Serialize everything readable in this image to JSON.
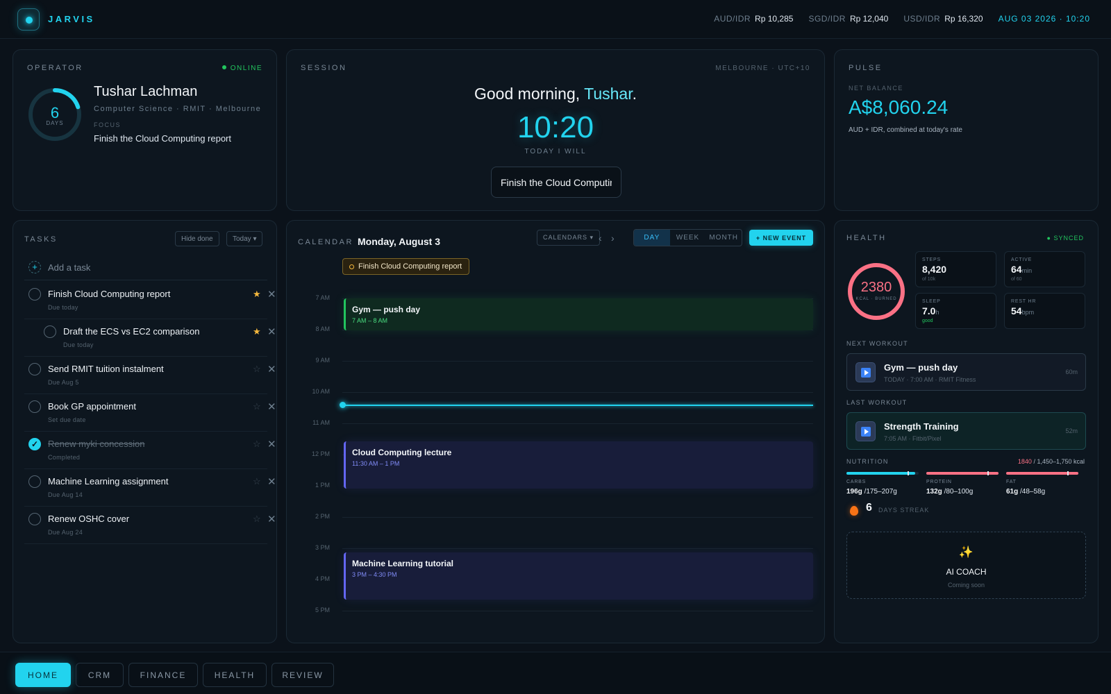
{
  "app": {
    "title": "JARVIS"
  },
  "header": {
    "rates": [
      {
        "label": "AUD/IDR",
        "value": "Rp 10,285"
      },
      {
        "label": "SGD/IDR",
        "value": "Rp 12,040"
      },
      {
        "label": "USD/IDR",
        "value": "Rp 16,320"
      }
    ],
    "datetime": "AUG 03 2026 · 10:20"
  },
  "operator": {
    "label": "OPERATOR",
    "status": "ONLINE",
    "days": "6",
    "days_label": "DAYS",
    "days_progress": 0.2,
    "name": "Tushar Lachman",
    "subtitle": "Computer Science · RMIT · Melbourne",
    "focus_label": "FOCUS",
    "focus": "Finish the Cloud Computing report"
  },
  "session": {
    "label": "SESSION",
    "location": "MELBOURNE · UTC+10",
    "greeting": "Good morning,",
    "greeting_name": "Tushar",
    "greeting_end": ".",
    "time": "10:20",
    "today_will_label": "TODAY I WILL",
    "today_will_value": "Finish the Cloud Computing report"
  },
  "pulse": {
    "label": "PULSE",
    "net_balance_label": "NET BALANCE",
    "net_balance": "A$8,060.24",
    "net_balance_note": "AUD + IDR, combined at today's rate"
  },
  "tasks": {
    "label": "TASKS",
    "hide_done": "Hide done",
    "filter": "Today ▾",
    "add_placeholder": "Add a task",
    "items": [
      {
        "title": "Finish Cloud Computing report",
        "due": "Due today",
        "starred": true,
        "done": false,
        "sub": false
      },
      {
        "title": "Draft the ECS vs EC2 comparison",
        "due": "Due today",
        "starred": true,
        "done": false,
        "sub": true
      },
      {
        "title": "Send RMIT tuition instalment",
        "due": "Due Aug 5",
        "starred": false,
        "done": false,
        "sub": false
      },
      {
        "title": "Book GP appointment",
        "due": "Set due date",
        "starred": false,
        "done": false,
        "sub": false
      },
      {
        "title": "Renew myki concession",
        "due": "Completed",
        "starred": false,
        "done": true,
        "sub": false
      },
      {
        "title": "Machine Learning assignment",
        "due": "Due Aug 14",
        "starred": false,
        "done": false,
        "sub": false
      },
      {
        "title": "Renew OSHC cover",
        "due": "Due Aug 24",
        "starred": false,
        "done": false,
        "sub": false
      }
    ],
    "star_on": "★",
    "star_off": "☆",
    "delete": "✕",
    "check": "✓"
  },
  "calendar": {
    "label": "CALENDAR",
    "date": "Monday, August 3",
    "calendars_btn": "CALENDARS ▾",
    "prev": "‹",
    "next": "›",
    "views": [
      "DAY",
      "WEEK",
      "MONTH"
    ],
    "active_view": "DAY",
    "new_event": "+ NEW EVENT",
    "all_day": "Finish Cloud Computing report",
    "hours": [
      "7 AM",
      "8 AM",
      "9 AM",
      "10 AM",
      "11 AM",
      "12 PM",
      "1 PM",
      "2 PM",
      "3 PM",
      "4 PM",
      "5 PM"
    ],
    "events": [
      {
        "title": "Gym — push day",
        "when": "7 AM – 8 AM"
      },
      {
        "title": "Cloud Computing lecture",
        "when": "11:30 AM – 1 PM"
      },
      {
        "title": "Machine Learning tutorial",
        "when": "3 PM – 4:30 PM"
      }
    ]
  },
  "health": {
    "label": "HEALTH",
    "synced": "● SYNCED",
    "kcal": "2380",
    "kcal_label": "KCAL · BURNED",
    "stats": [
      {
        "label": "STEPS",
        "value": "8,420",
        "unit": "",
        "note": "of 10k"
      },
      {
        "label": "ACTIVE",
        "value": "64",
        "unit": "min",
        "note": "of 60"
      },
      {
        "label": "SLEEP",
        "value": "7.0",
        "unit": "h",
        "note": "good"
      },
      {
        "label": "REST HR",
        "value": "54",
        "unit": "bpm",
        "note": ""
      }
    ],
    "next_workout_label": "NEXT WORKOUT",
    "next_workout": {
      "title": "Gym — push day",
      "sub": "TODAY · 7:00 AM · RMIT Fitness",
      "duration": "60m"
    },
    "last_workout_label": "LAST WORKOUT",
    "last_workout": {
      "title": "Strength Training",
      "sub": "7:05 AM · Fitbit/Pixel",
      "duration": "52m"
    },
    "nutrition_label": "NUTRITION",
    "nutrition_total": "1840",
    "nutrition_range": " / 1,450–1,750 kcal",
    "macros": [
      {
        "label": "CARBS",
        "value": "196g",
        "range": " /175–207g",
        "color": "#22d3ee",
        "fill": 0.95
      },
      {
        "label": "PROTEIN",
        "value": "132g",
        "range": " /80–100g",
        "color": "#fb7185",
        "fill": 1.0
      },
      {
        "label": "FAT",
        "value": "61g",
        "range": " /48–58g",
        "color": "#fb7185",
        "fill": 1.0
      }
    ],
    "streak": "6",
    "streak_label": "DAYS STREAK",
    "ai_coach": {
      "icon": "✨",
      "title": "AI COACH",
      "sub": "Coming soon"
    }
  },
  "nav": {
    "items": [
      "HOME",
      "CRM",
      "FINANCE",
      "HEALTH",
      "REVIEW"
    ],
    "active": "HOME"
  },
  "colors": {
    "accent": "#22d3ee",
    "online": "#22c55e",
    "calorie": "#fb7185",
    "star": "#f5b83d"
  }
}
